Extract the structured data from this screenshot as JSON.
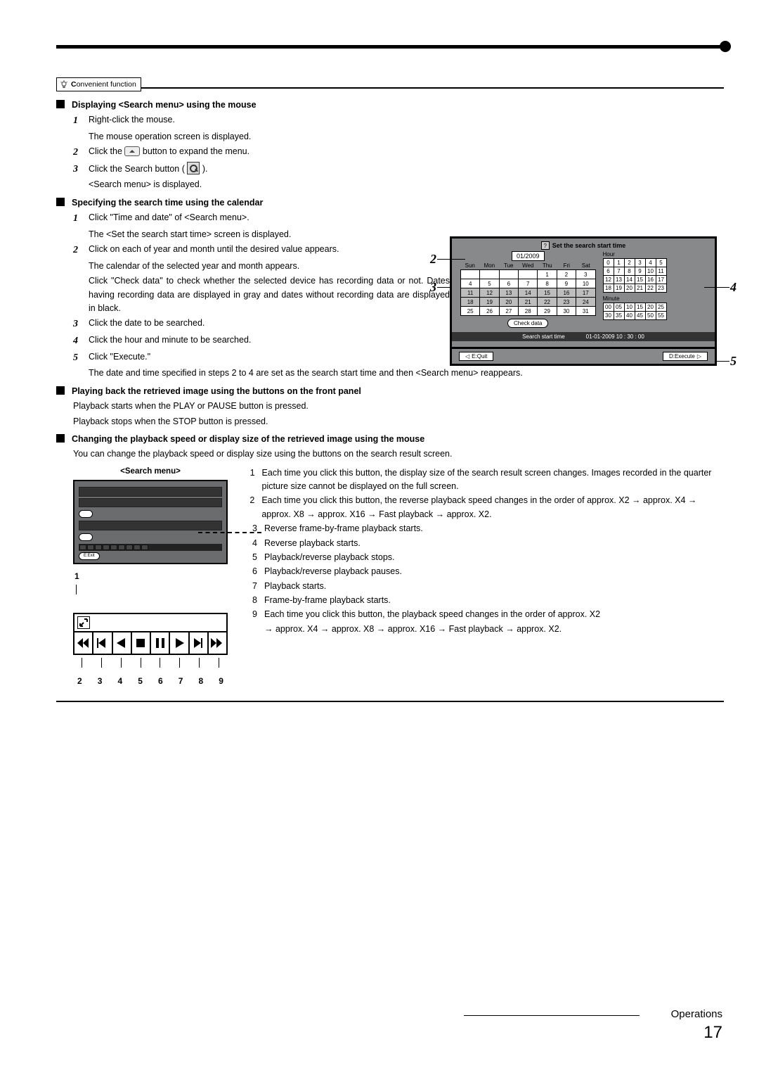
{
  "tag": {
    "label": "Convenient function"
  },
  "sec1": {
    "title": "Displaying <Search menu> using the mouse",
    "s1": "Right-click the mouse.",
    "s1b": "The mouse operation screen is displayed.",
    "s2a": "Click the ",
    "s2b": " button to expand the menu.",
    "s3a": "Click the Search button (",
    "s3b": ").",
    "s3c": "<Search menu> is displayed."
  },
  "sec2": {
    "title": "Specifying the search time using the calendar",
    "s1": "Click \"Time and date\" of <Search menu>.",
    "s1b": "The <Set the search start time> screen is displayed.",
    "s2": "Click on each of year and month until the desired value appears.",
    "s2b": "The calendar of the selected year and month appears.",
    "s2c": "Click \"Check data\" to check whether the selected device has recording data or not. Dates having recording data are displayed in gray and dates without recording data are displayed in black.",
    "s3": "Click the date to be searched.",
    "s4": "Click the hour and minute to be searched.",
    "s5": "Click \"Execute.\"",
    "s5b": "The date and time specified in steps 2 to 4 are set as the search start time and then <Search menu> reappears."
  },
  "sec3": {
    "title": "Playing back the retrieved image using the buttons on the front panel",
    "l1": "Playback starts when the PLAY or PAUSE button is pressed.",
    "l2": "Playback stops when the STOP button is pressed."
  },
  "sec4": {
    "title": "Changing the playback speed or display size of the retrieved image using the mouse",
    "l1": "You can change the playback speed or display size using the buttons on the search result screen."
  },
  "cal": {
    "title": "Set the search start time",
    "month": "01/2009",
    "dow": [
      "Sun",
      "Mon",
      "Tue",
      "Wed",
      "Thu",
      "Fri",
      "Sat"
    ],
    "rows": [
      [
        "",
        "",
        "",
        "",
        "1",
        "2",
        "3"
      ],
      [
        "4",
        "5",
        "6",
        "7",
        "8",
        "9",
        "10"
      ],
      [
        "11",
        "12",
        "13",
        "14",
        "15",
        "16",
        "17"
      ],
      [
        "18",
        "19",
        "20",
        "21",
        "22",
        "23",
        "24"
      ],
      [
        "25",
        "26",
        "27",
        "28",
        "29",
        "30",
        "31"
      ]
    ],
    "check": "Check data",
    "hourLbl": "Hour",
    "hours": [
      [
        "0",
        "1",
        "2",
        "3",
        "4",
        "5"
      ],
      [
        "6",
        "7",
        "8",
        "9",
        "10",
        "11"
      ],
      [
        "12",
        "13",
        "14",
        "15",
        "16",
        "17"
      ],
      [
        "18",
        "19",
        "20",
        "21",
        "22",
        "23"
      ]
    ],
    "minLbl": "Minute",
    "mins": [
      [
        "00",
        "05",
        "10",
        "15",
        "20",
        "25"
      ],
      [
        "30",
        "35",
        "40",
        "45",
        "50",
        "55"
      ]
    ],
    "status1": "Search start time",
    "status2": "01-01-2009    10 : 30 : 00",
    "quit": "E:Quit",
    "exec": "D:Execute",
    "co": {
      "c2": "2",
      "c3": "3",
      "c4": "4",
      "c5": "5"
    }
  },
  "sm": {
    "title": "<Search menu>",
    "exit": "E:Exit",
    "one": "1",
    "nums": [
      "2",
      "3",
      "4",
      "5",
      "6",
      "7",
      "8",
      "9"
    ]
  },
  "pb": {
    "items": [
      {
        "n": "1",
        "t": "Each time you click this button, the display size of the search result screen changes. Images recorded in the quarter picture size cannot be displayed on the full screen."
      },
      {
        "n": "2",
        "t": "Each time you click this button, the reverse playback speed changes in the order of approx. X2 → approx. X4 → approx. X8 → approx. X16 → Fast playback → approx. X2."
      },
      {
        "n": "3",
        "t": "Reverse frame-by-frame playback starts."
      },
      {
        "n": "4",
        "t": "Reverse playback starts."
      },
      {
        "n": "5",
        "t": "Playback/reverse playback stops."
      },
      {
        "n": "6",
        "t": "Playback/reverse playback pauses."
      },
      {
        "n": "7",
        "t": "Playback starts."
      },
      {
        "n": "8",
        "t": "Frame-by-frame playback starts."
      },
      {
        "n": "9",
        "t": "Each time you click this button, the playback speed changes in the order of approx. X2"
      }
    ],
    "item9b": "→ approx. X4 → approx. X8 → approx. X16 → Fast playback → approx. X2."
  },
  "footer": {
    "ops": "Operations",
    "page": "17"
  }
}
